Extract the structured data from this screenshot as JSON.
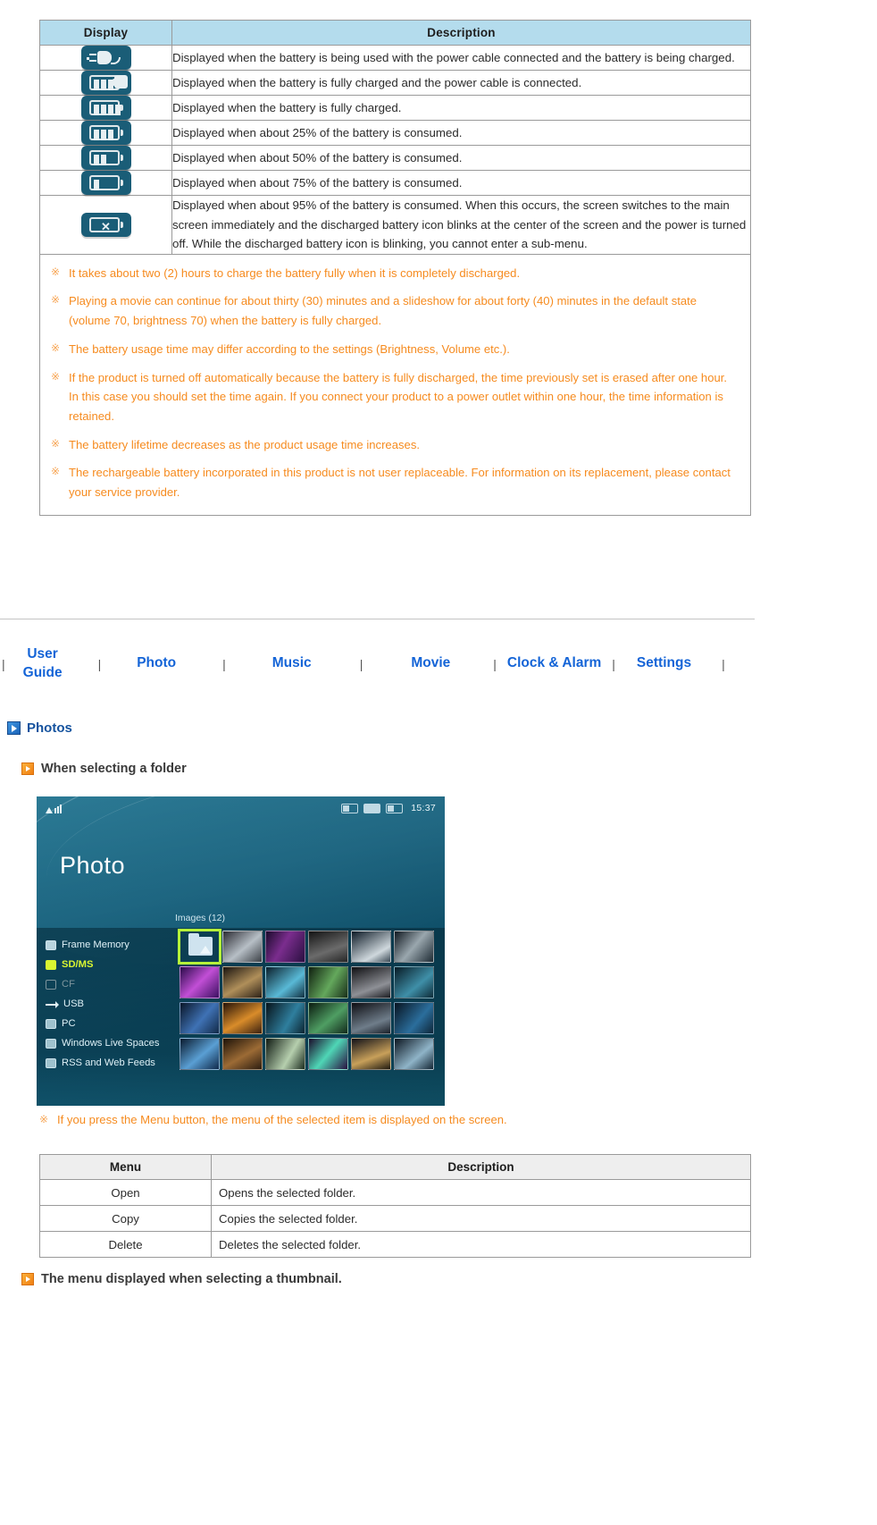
{
  "battery_table": {
    "headers": [
      "Display",
      "Description"
    ],
    "rows": [
      {
        "icon": "battery-charging-plug-icon",
        "description": "Displayed when the battery is being used with the power cable connected and the battery is being charged."
      },
      {
        "icon": "battery-full-plug-icon",
        "description": "Displayed when the battery is fully charged and the power cable is connected."
      },
      {
        "icon": "battery-full-icon",
        "description": "Displayed when the battery is fully charged."
      },
      {
        "icon": "battery-three-quarter-icon",
        "description": "Displayed when about 25% of the battery is consumed."
      },
      {
        "icon": "battery-half-icon",
        "description": "Displayed when about 50% of the battery is consumed."
      },
      {
        "icon": "battery-quarter-icon",
        "description": "Displayed when about 75% of the battery is consumed."
      },
      {
        "icon": "battery-empty-x-icon",
        "description": "Displayed when about 95% of the battery is consumed. When this occurs, the screen switches to the main screen immediately and the discharged battery icon blinks at the center of the screen and the power is turned off. While the discharged battery icon is blinking, you cannot enter a sub-menu."
      }
    ]
  },
  "notes": {
    "marker": "※",
    "items": [
      "It takes about two (2) hours to charge the battery fully when it is completely discharged.",
      "Playing a movie can continue for about thirty (30) minutes and a slideshow for about forty (40) minutes in the default state (volume 70, brightness 70) when the battery is fully charged.",
      "The battery usage time may differ according to the settings (Brightness, Volume etc.).",
      "If the product is turned off automatically because the battery is fully discharged, the time previously set is erased after one hour. In this case you should set the time again. If you connect your product to a power outlet within one hour, the time information is retained.",
      "The battery lifetime decreases as the product usage time increases.",
      "The rechargeable battery incorporated in this product is not user replaceable. For information on its replacement, please contact your service provider."
    ]
  },
  "nav": {
    "separator": "|",
    "items": [
      {
        "label": "User\nGuide"
      },
      {
        "label": "Photo"
      },
      {
        "label": "Music"
      },
      {
        "label": "Movie"
      },
      {
        "label": "Clock & Alarm"
      },
      {
        "label": "Settings"
      }
    ]
  },
  "headings": {
    "photos": "Photos",
    "when_selecting_folder": "When selecting a folder",
    "thumbnail_menu": "The menu displayed when selecting a thumbnail."
  },
  "device": {
    "status": {
      "signal": "signal-bars-icon",
      "icon1": "usb-status-icon",
      "icon2": "memory-card-status-icon",
      "icon3": "battery-status-icon",
      "time": "15:37"
    },
    "title": "Photo",
    "image_count": "Images (12)",
    "sidebar": [
      {
        "label": "Frame Memory",
        "state": "normal",
        "icon": "frame-memory-icon"
      },
      {
        "label": "SD/MS",
        "state": "active",
        "icon": "sd-ms-icon"
      },
      {
        "label": "CF",
        "state": "disabled",
        "icon": "cf-icon"
      },
      {
        "label": "USB",
        "state": "normal",
        "icon": "usb-icon"
      },
      {
        "label": "PC",
        "state": "normal",
        "icon": "pc-icon"
      },
      {
        "label": "Windows Live Spaces",
        "state": "normal",
        "icon": "windows-live-spaces-icon"
      },
      {
        "label": "RSS and Web Feeds",
        "state": "normal",
        "icon": "rss-web-feeds-icon"
      }
    ]
  },
  "device_note": "If you press the Menu button, the menu of the selected item is displayed on the screen.",
  "menu_table": {
    "headers": [
      "Menu",
      "Description"
    ],
    "rows": [
      {
        "menu": "Open",
        "description": "Opens the selected folder."
      },
      {
        "menu": "Copy",
        "description": "Copies the selected folder."
      },
      {
        "menu": "Delete",
        "description": "Deletes the selected folder."
      }
    ]
  },
  "colors": {
    "table_header": "#b4dced",
    "note_orange": "#f68b1f",
    "nav_blue": "#1464d7",
    "heading_blue": "#14529e",
    "battery_icon_bg": "#1a5d77",
    "device_highlight": "#d9f531"
  }
}
